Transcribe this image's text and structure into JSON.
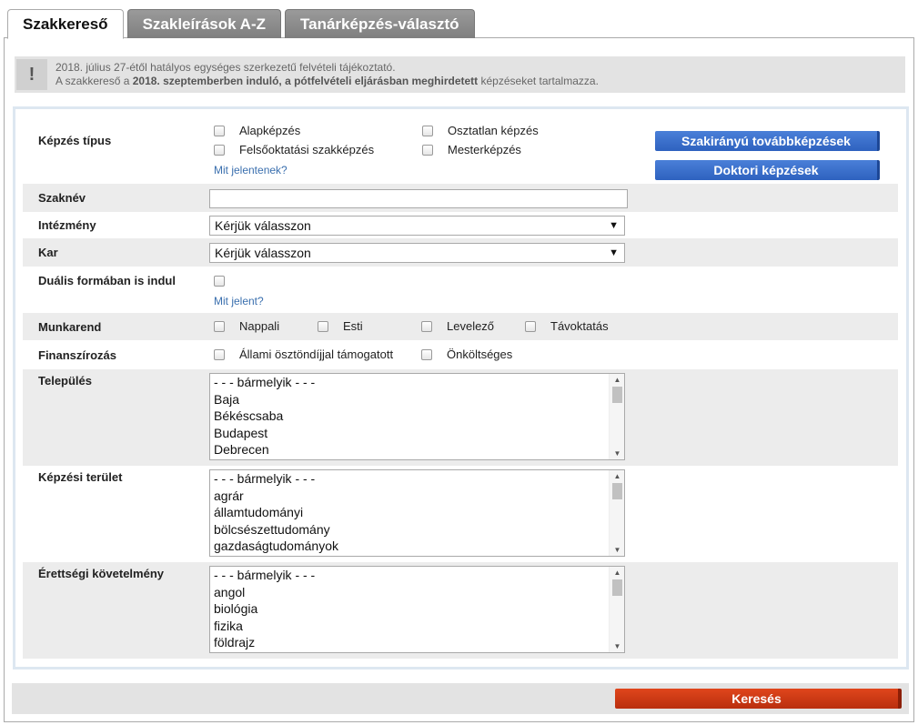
{
  "tabs": [
    {
      "label": "Szakkereső",
      "active": true
    },
    {
      "label": "Szakleírások A-Z",
      "active": false
    },
    {
      "label": "Tanárképzés-választó",
      "active": false
    }
  ],
  "notice": {
    "icon": "!",
    "line1": "2018. július 27-étől hatályos egységes szerkezetű felvételi tájékoztató.",
    "line2_pre": "A szakkereső a ",
    "line2_bold": "2018. szeptemberben induló, a pótfelvételi eljárásban meghirdetett",
    "line2_post": " képzéseket tartalmazza."
  },
  "kepzes_tipus": {
    "label": "Képzés típus",
    "options": [
      "Alapképzés",
      "Osztatlan képzés",
      "Felsőoktatási szakképzés",
      "Mesterképzés"
    ],
    "help_link": "Mit jelentenek?"
  },
  "side_buttons": {
    "szakiranyu": "Szakirányú továbbképzések",
    "doktori": "Doktori képzések"
  },
  "szaknev": {
    "label": "Szaknév",
    "value": ""
  },
  "intezmeny": {
    "label": "Intézmény",
    "selected": "Kérjük válasszon"
  },
  "kar": {
    "label": "Kar",
    "selected": "Kérjük válasszon"
  },
  "dualis": {
    "label": "Duális formában is indul",
    "help_link": "Mit jelent?"
  },
  "munkarend": {
    "label": "Munkarend",
    "options": [
      "Nappali",
      "Esti",
      "Levelező",
      "Távoktatás"
    ]
  },
  "finanszirozas": {
    "label": "Finanszírozás",
    "options": [
      "Állami ösztöndíjjal támogatott",
      "Önköltséges"
    ]
  },
  "telepules": {
    "label": "Település",
    "items": [
      "- - - bármelyik - - -",
      "Baja",
      "Békéscsaba",
      "Budapest",
      "Debrecen"
    ]
  },
  "kepzesi_terulet": {
    "label": "Képzési terület",
    "items": [
      "- - - bármelyik - - -",
      "agrár",
      "államtudományi",
      "bölcsészettudomány",
      "gazdaságtudományok"
    ]
  },
  "erettsegi": {
    "label": "Érettségi követelmény",
    "items": [
      "- - - bármelyik - - -",
      "angol",
      "biológia",
      "fizika",
      "földrajz"
    ]
  },
  "search_button": "Keresés"
}
